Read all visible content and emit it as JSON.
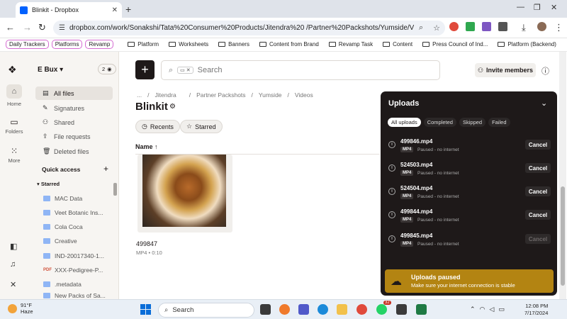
{
  "browser": {
    "tab_title": "Blinkit - Dropbox",
    "url": "dropbox.com/work/Sonakshi/Tata%20Consumer%20Products/Jitendra%20          /Partner%20Packshots/Yumside/Videos/...",
    "bookmarks_pills": [
      "Daily Trackers",
      "Platforms",
      "Revamp"
    ],
    "bookmarks_folders": [
      "Platform",
      "Worksheets",
      "Banners",
      "Content from Brand",
      "Revamp Task",
      "Content",
      "Press Council of Ind...",
      "Platform (Backend)"
    ]
  },
  "rail": {
    "home": "Home",
    "folders": "Folders",
    "more": "More"
  },
  "sidebar": {
    "account": "E Bux",
    "members": "2",
    "items": [
      {
        "label": "All files"
      },
      {
        "label": "Signatures"
      },
      {
        "label": "Shared"
      },
      {
        "label": "File requests"
      },
      {
        "label": "Deleted files"
      }
    ],
    "quick_access": "Quick access",
    "starred": "Starred",
    "starred_items": [
      "MAC Data",
      "Veet Botanic Ins...",
      "Cola Coca",
      "Creative",
      "IND-20017340-1...",
      "XXX-Pedigree-P...",
      ".metadata",
      "New Packs of Sa..."
    ],
    "pdf_tag": "PDF"
  },
  "main": {
    "search_placeholder": "Search",
    "invite": "Invite members",
    "breadcrumbs": [
      "...",
      "/",
      "Jitendra",
      "/",
      "Partner Packshots",
      "/",
      "Yumside",
      "/",
      "Videos"
    ],
    "title": "Blinkit",
    "recents": "Recents",
    "starred": "Starred",
    "sort_label": "Name",
    "file_name": "499847",
    "file_meta": "MP4 • 0:10"
  },
  "uploads": {
    "title": "Uploads",
    "tabs": [
      "All uploads",
      "Completed",
      "Skipped",
      "Failed"
    ],
    "items": [
      {
        "name": "499846.mp4",
        "type": "MP4",
        "status": "Paused - no internet",
        "action": "Cancel"
      },
      {
        "name": "524503.mp4",
        "type": "MP4",
        "status": "Paused - no internet",
        "action": "Cancel"
      },
      {
        "name": "524504.mp4",
        "type": "MP4",
        "status": "Paused - no internet",
        "action": "Cancel"
      },
      {
        "name": "499844.mp4",
        "type": "MP4",
        "status": "Paused - no internet",
        "action": "Cancel"
      },
      {
        "name": "499845.mp4",
        "type": "MP4",
        "status": "Paused - no internet",
        "action": "Cancel"
      }
    ],
    "banner_title": "Uploads paused",
    "banner_text": "Make sure your internet connection is stable"
  },
  "taskbar": {
    "temp": "91°F",
    "weather": "Haze",
    "search": "Search",
    "badge": "32",
    "time": "12:08 PM",
    "date": "7/17/2024"
  }
}
